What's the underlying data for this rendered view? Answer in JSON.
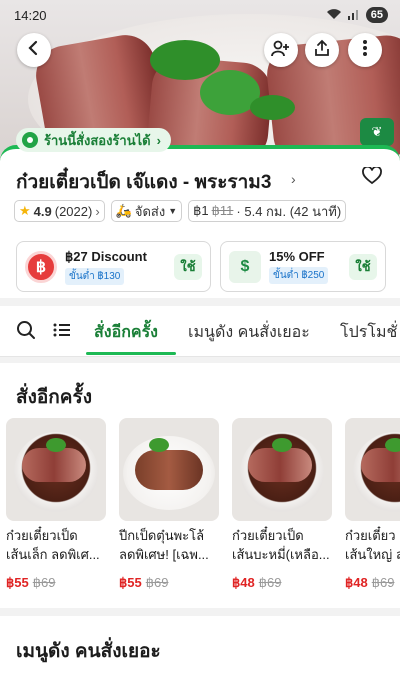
{
  "status_bar": {
    "time": "14:20",
    "battery": "65"
  },
  "store": {
    "badge": "ร้านนี้สั่งสองร้านได้",
    "name": "ก๋วยเตี๋ยวเป็ด เจ๊แดง - พระราม3",
    "rating": "4.9",
    "rating_count": "(2022)",
    "delivery_label": "จัดส่ง",
    "fee_now": "฿1",
    "fee_old": "฿11",
    "distance": "· 5.4 กม. (42 นาที)"
  },
  "promos": [
    {
      "icon": "฿",
      "title": "฿27 Discount",
      "min": "ขั้นต่ำ ฿130",
      "use": "ใช้"
    },
    {
      "icon": "$",
      "title": "15% OFF",
      "min": "ขั้นต่ำ ฿250",
      "use": "ใช้"
    }
  ],
  "tabs": [
    "สั่งอีกครั้ง",
    "เมนูดัง คนสั่งเยอะ",
    "โปรโมชั่"
  ],
  "section": {
    "title": "สั่งอีกครั้ง",
    "items": [
      {
        "name1": "ก๋วยเตี๋ยวเป็ด",
        "name2": "เส้นเล็ก ลดพิเศ...",
        "price": "฿55",
        "old": "฿69"
      },
      {
        "name1": "ปีกเป็ดตุ๋นพะโล้",
        "name2": "ลดพิเศษ! [เฉพ...",
        "price": "฿55",
        "old": "฿69"
      },
      {
        "name1": "ก๋วยเตี๋ยวเป็ด",
        "name2": "เส้นบะหมี่(เหลือ...",
        "price": "฿48",
        "old": "฿69"
      },
      {
        "name1": "ก๋วยเตี๋ยว",
        "name2": "เส้นใหญ่ ล",
        "price": "฿48",
        "old": "฿69"
      }
    ]
  },
  "section2": {
    "title": "เมนูดัง คนสั่งเยอะ"
  },
  "colors": {
    "accent": "#1db954",
    "price": "#e02424"
  }
}
